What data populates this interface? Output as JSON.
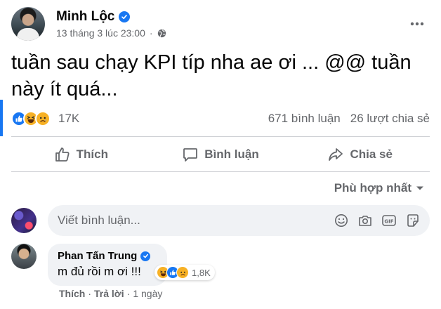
{
  "post": {
    "author": "Minh Lộc",
    "timestamp": "13 tháng 3 lúc 23:00",
    "dot": "·",
    "text": "tuần sau chạy KPI típ nha ae ơi ... @@ tuần này ít quá..."
  },
  "summary": {
    "reaction_icons": [
      "like-icon",
      "haha-icon",
      "sad-icon"
    ],
    "reaction_count": "17K",
    "comments": "671 bình luận",
    "shares": "26 lượt chia sẻ"
  },
  "actions": {
    "like": "Thích",
    "comment": "Bình luận",
    "share": "Chia sẻ"
  },
  "sort": {
    "label": "Phù hợp nhất"
  },
  "composer": {
    "placeholder": "Viết bình luận...",
    "icons": [
      "emoji-icon",
      "camera-icon",
      "gif-icon",
      "sticker-icon"
    ]
  },
  "comment": {
    "author": "Phan Tấn Trung",
    "text": "m đủ rồi m ơi !!!",
    "reaction_count": "1,8K",
    "like_label": "Thích",
    "sep": "·",
    "reply_label": "Trả lời",
    "time": "1 ngày"
  },
  "colors": {
    "accent": "#1877f2",
    "secondary_text": "#65676b",
    "bubble": "#f0f2f5",
    "emoji_yellow": "#f7b125"
  }
}
